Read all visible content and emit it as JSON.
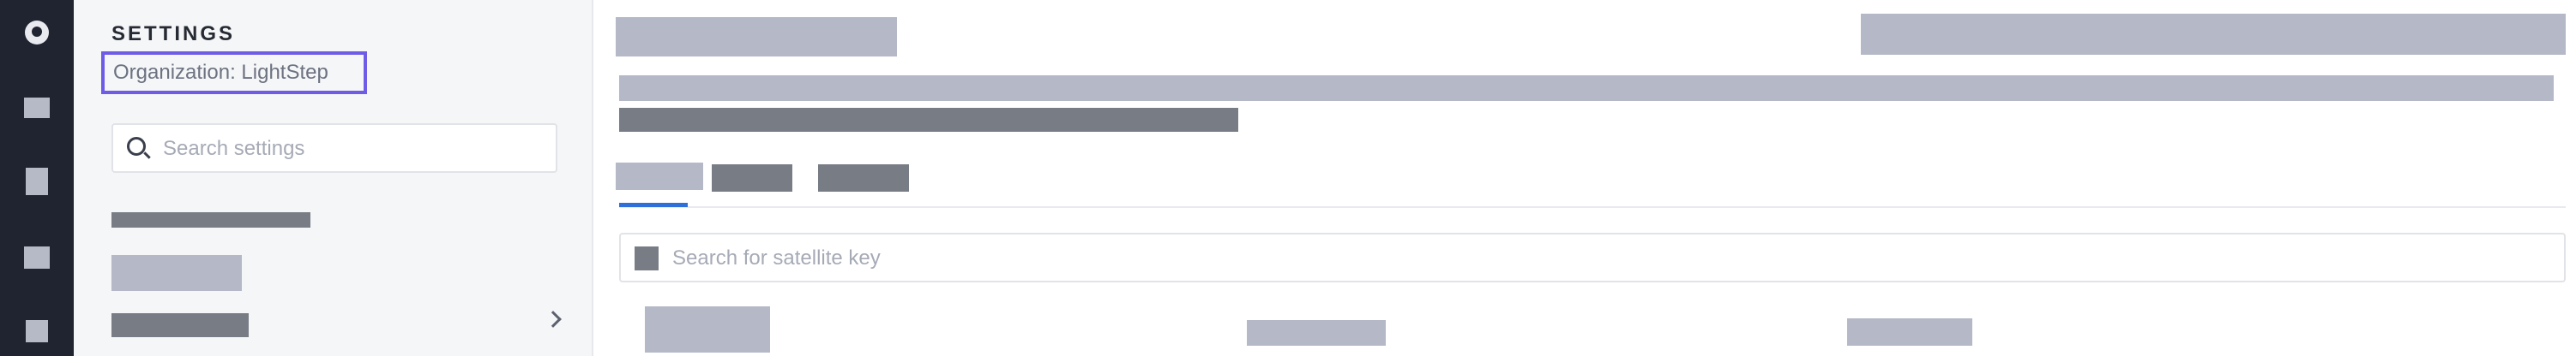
{
  "settings_panel": {
    "title": "SETTINGS",
    "organization_label": "Organization: LightStep",
    "search": {
      "placeholder": "Search settings"
    }
  },
  "main": {
    "satellite_search": {
      "placeholder": "Search for satellite key"
    }
  },
  "icons": {
    "rail": [
      "app-logo-icon",
      "nav-icon",
      "document-icon",
      "nav-icon",
      "nav-icon"
    ],
    "search": "search-icon",
    "chevron": "chevron-right-icon"
  },
  "colors": {
    "rail_background": "#1f2430",
    "panel_background": "#f5f6f8",
    "highlight_border": "#6e5ce6",
    "active_tab": "#2f6fd9",
    "placeholder_light": "#b5b8c6",
    "placeholder_dark": "#787d85"
  }
}
